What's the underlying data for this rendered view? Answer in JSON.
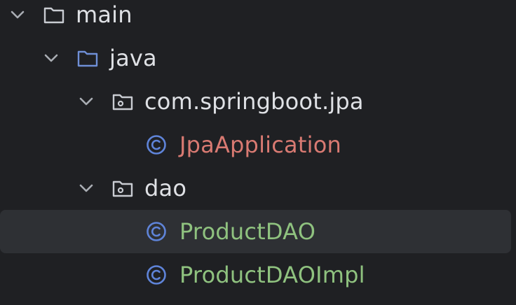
{
  "tree": {
    "items": [
      {
        "label": "main",
        "kind": "folder",
        "icon": "folder-icon",
        "expanded": true
      },
      {
        "label": "java",
        "kind": "source-folder",
        "icon": "source-folder-icon",
        "expanded": true
      },
      {
        "label": "com.springboot.jpa",
        "kind": "package",
        "icon": "package-icon",
        "expanded": true
      },
      {
        "label": "JpaApplication",
        "kind": "class",
        "icon": "class-icon",
        "text_color": "#d97a72"
      },
      {
        "label": "dao",
        "kind": "package",
        "icon": "package-icon",
        "expanded": true
      },
      {
        "label": "ProductDAO",
        "kind": "class",
        "icon": "class-icon",
        "text_color": "#8fc27f",
        "selected": true
      },
      {
        "label": "ProductDAOImpl",
        "kind": "class",
        "icon": "class-icon",
        "text_color": "#8fc27f"
      }
    ]
  },
  "colors": {
    "background": "#1f2023",
    "selection": "#2e3034",
    "text": "#dfe1e5",
    "folder_icon": "#c9ccd2",
    "source_folder_icon": "#6f8fd6",
    "class_icon": "#5f84d9",
    "modified_text": "#d97a72",
    "added_text": "#8fc27f"
  }
}
